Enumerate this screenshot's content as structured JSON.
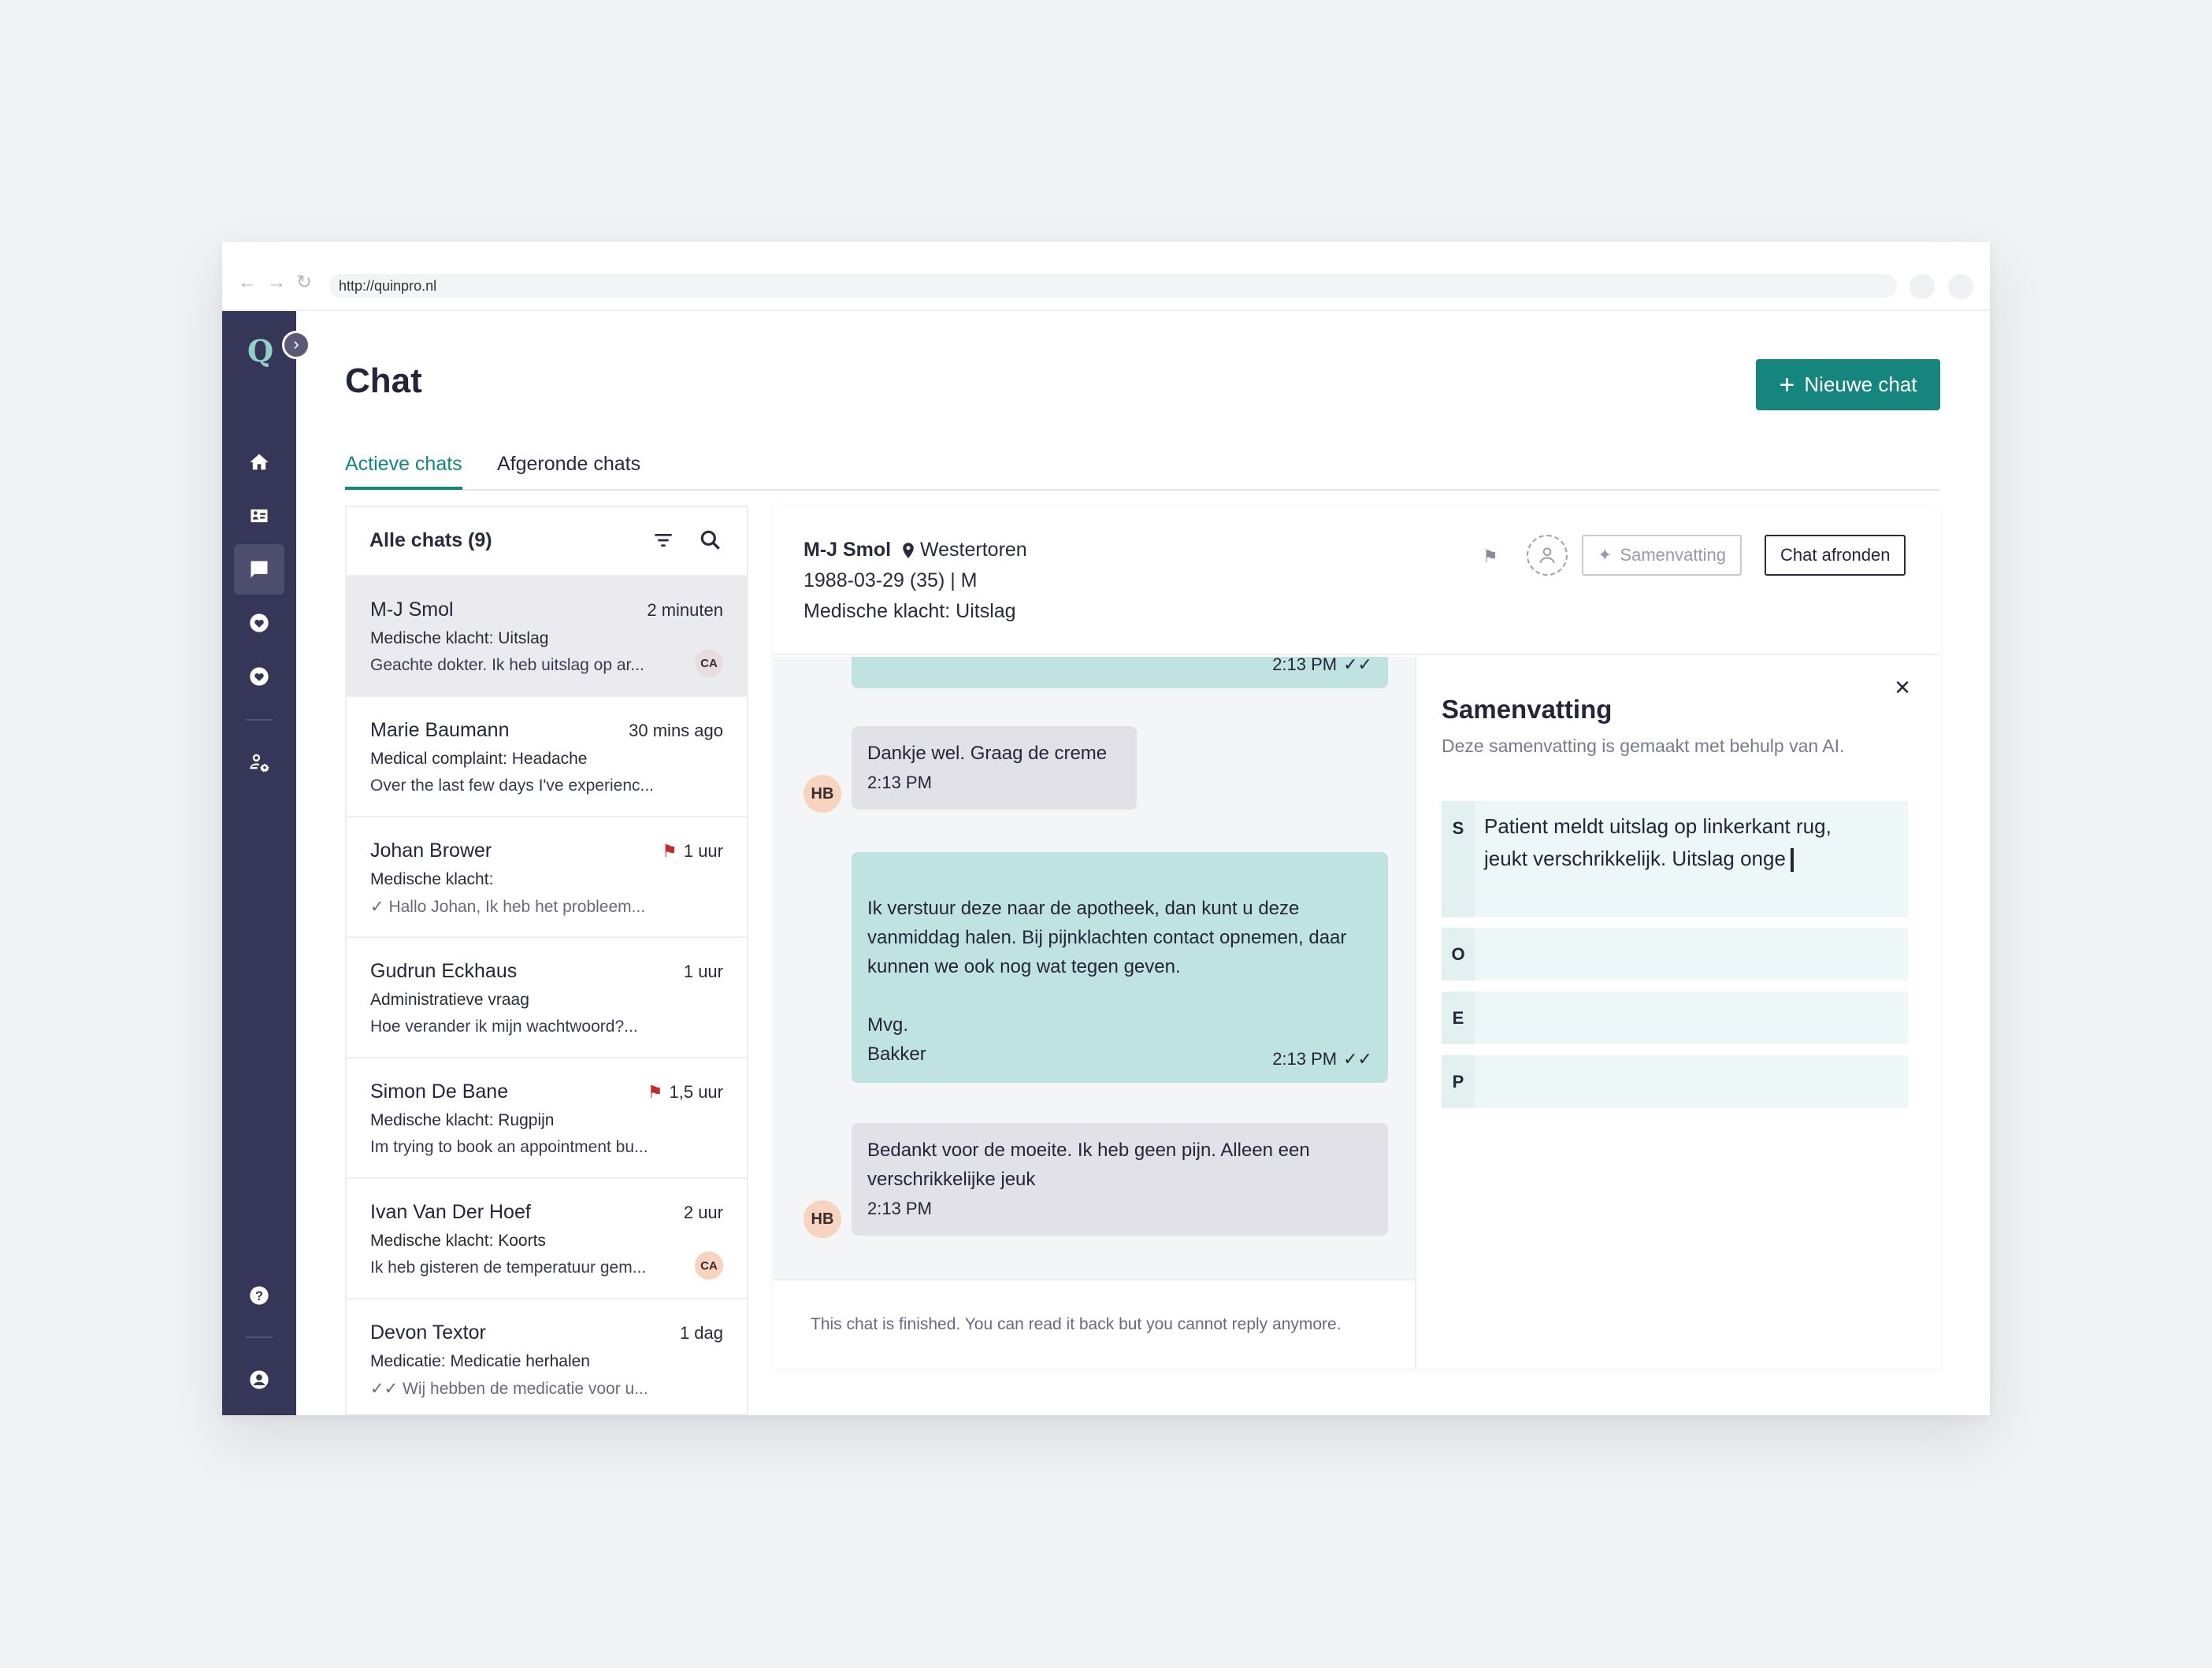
{
  "browser": {
    "url": "http://quinpro.nl"
  },
  "app": {
    "logo": "Q",
    "colors": {
      "accent": "#15857e",
      "sidebar": "#363658",
      "doctor_bubble": "#bfe3e1",
      "patient_bubble": "#e1e1e7"
    }
  },
  "sidebar": {
    "items": [
      {
        "icon": "home-icon"
      },
      {
        "icon": "contact-card-icon"
      },
      {
        "icon": "chat-icon",
        "active": true
      },
      {
        "icon": "heart-icon"
      },
      {
        "icon": "heart-icon"
      },
      {
        "icon": "user-settings-icon"
      },
      {
        "icon": "help-icon"
      },
      {
        "icon": "account-icon"
      }
    ]
  },
  "header": {
    "title": "Chat",
    "new_chat_label": "Nieuwe chat"
  },
  "tabs": [
    {
      "label": "Actieve chats",
      "active": true
    },
    {
      "label": "Afgeronde chats"
    }
  ],
  "list": {
    "title": "Alle chats (9)",
    "items": [
      {
        "name": "M-J Smol",
        "time": "2 minuten",
        "subject": "Medische klacht: Uitslag",
        "preview": "Geachte dokter. Ik heb uitslag op ar...",
        "badge": "CA"
      },
      {
        "name": "Marie Baumann",
        "time": "30 mins ago",
        "subject": "Medical complaint: Headache",
        "preview": "Over the last few days I've experienc..."
      },
      {
        "name": "Johan Brower",
        "time": "1 uur",
        "flagged": true,
        "subject": "Medische klacht:",
        "preview": "Hallo Johan, Ik heb het probleem..."
      },
      {
        "name": "Gudrun Eckhaus",
        "time": "1 uur",
        "subject": "Administratieve vraag",
        "preview": "Hoe verander ik mijn wachtwoord?..."
      },
      {
        "name": "Simon De Bane",
        "time": "1,5 uur",
        "flagged": true,
        "subject": "Medische klacht: Rugpijn",
        "preview": "Im trying to book an appointment bu..."
      },
      {
        "name": "Ivan Van Der Hoef",
        "time": "2 uur",
        "subject": "Medische klacht: Koorts",
        "preview": "Ik heb gisteren de temperatuur gem...",
        "badge": "CA"
      },
      {
        "name": "Devon Textor",
        "time": "1 dag",
        "subject": "Medicatie: Medicatie herhalen",
        "preview": "Wij hebben de medicatie voor u..."
      }
    ]
  },
  "conversation": {
    "patient_name": "M-J Smol",
    "location": "Westertoren",
    "dob_line": "1988-03-29 (35) | M",
    "complaint": "Medische klacht: Uitslag",
    "summary_button": "Samenvatting",
    "finish_button": "Chat afronden",
    "messages": [
      {
        "from": "doctor",
        "text": "",
        "time": "2:13 PM"
      },
      {
        "from": "patient",
        "initials": "HB",
        "text": "Dankje wel. Graag de creme",
        "time": "2:13 PM"
      },
      {
        "from": "doctor",
        "text": "Ik verstuur deze naar de apotheek, dan kunt u deze vanmiddag halen. Bij pijnklachten contact opnemen, daar kunnen we ook nog wat tegen geven.\n\nMvg.\nBakker",
        "time": "2:13 PM"
      },
      {
        "from": "patient",
        "initials": "HB",
        "text": "Bedankt voor de moeite. Ik heb geen pijn. Alleen een verschrikkelijke jeuk",
        "time": "2:13 PM"
      }
    ],
    "finished_notice": "This chat is finished. You can read it back but you cannot reply anymore."
  },
  "summary": {
    "title": "Samenvatting",
    "subtitle": "Deze samenvatting is gemaakt met behulp van AI.",
    "sections": [
      {
        "letter": "S",
        "text": "Patient meldt uitslag op linkerkant rug, jeukt verschrikkelijk. Uitslag onge"
      },
      {
        "letter": "O",
        "text": ""
      },
      {
        "letter": "E",
        "text": ""
      },
      {
        "letter": "P",
        "text": ""
      }
    ]
  }
}
